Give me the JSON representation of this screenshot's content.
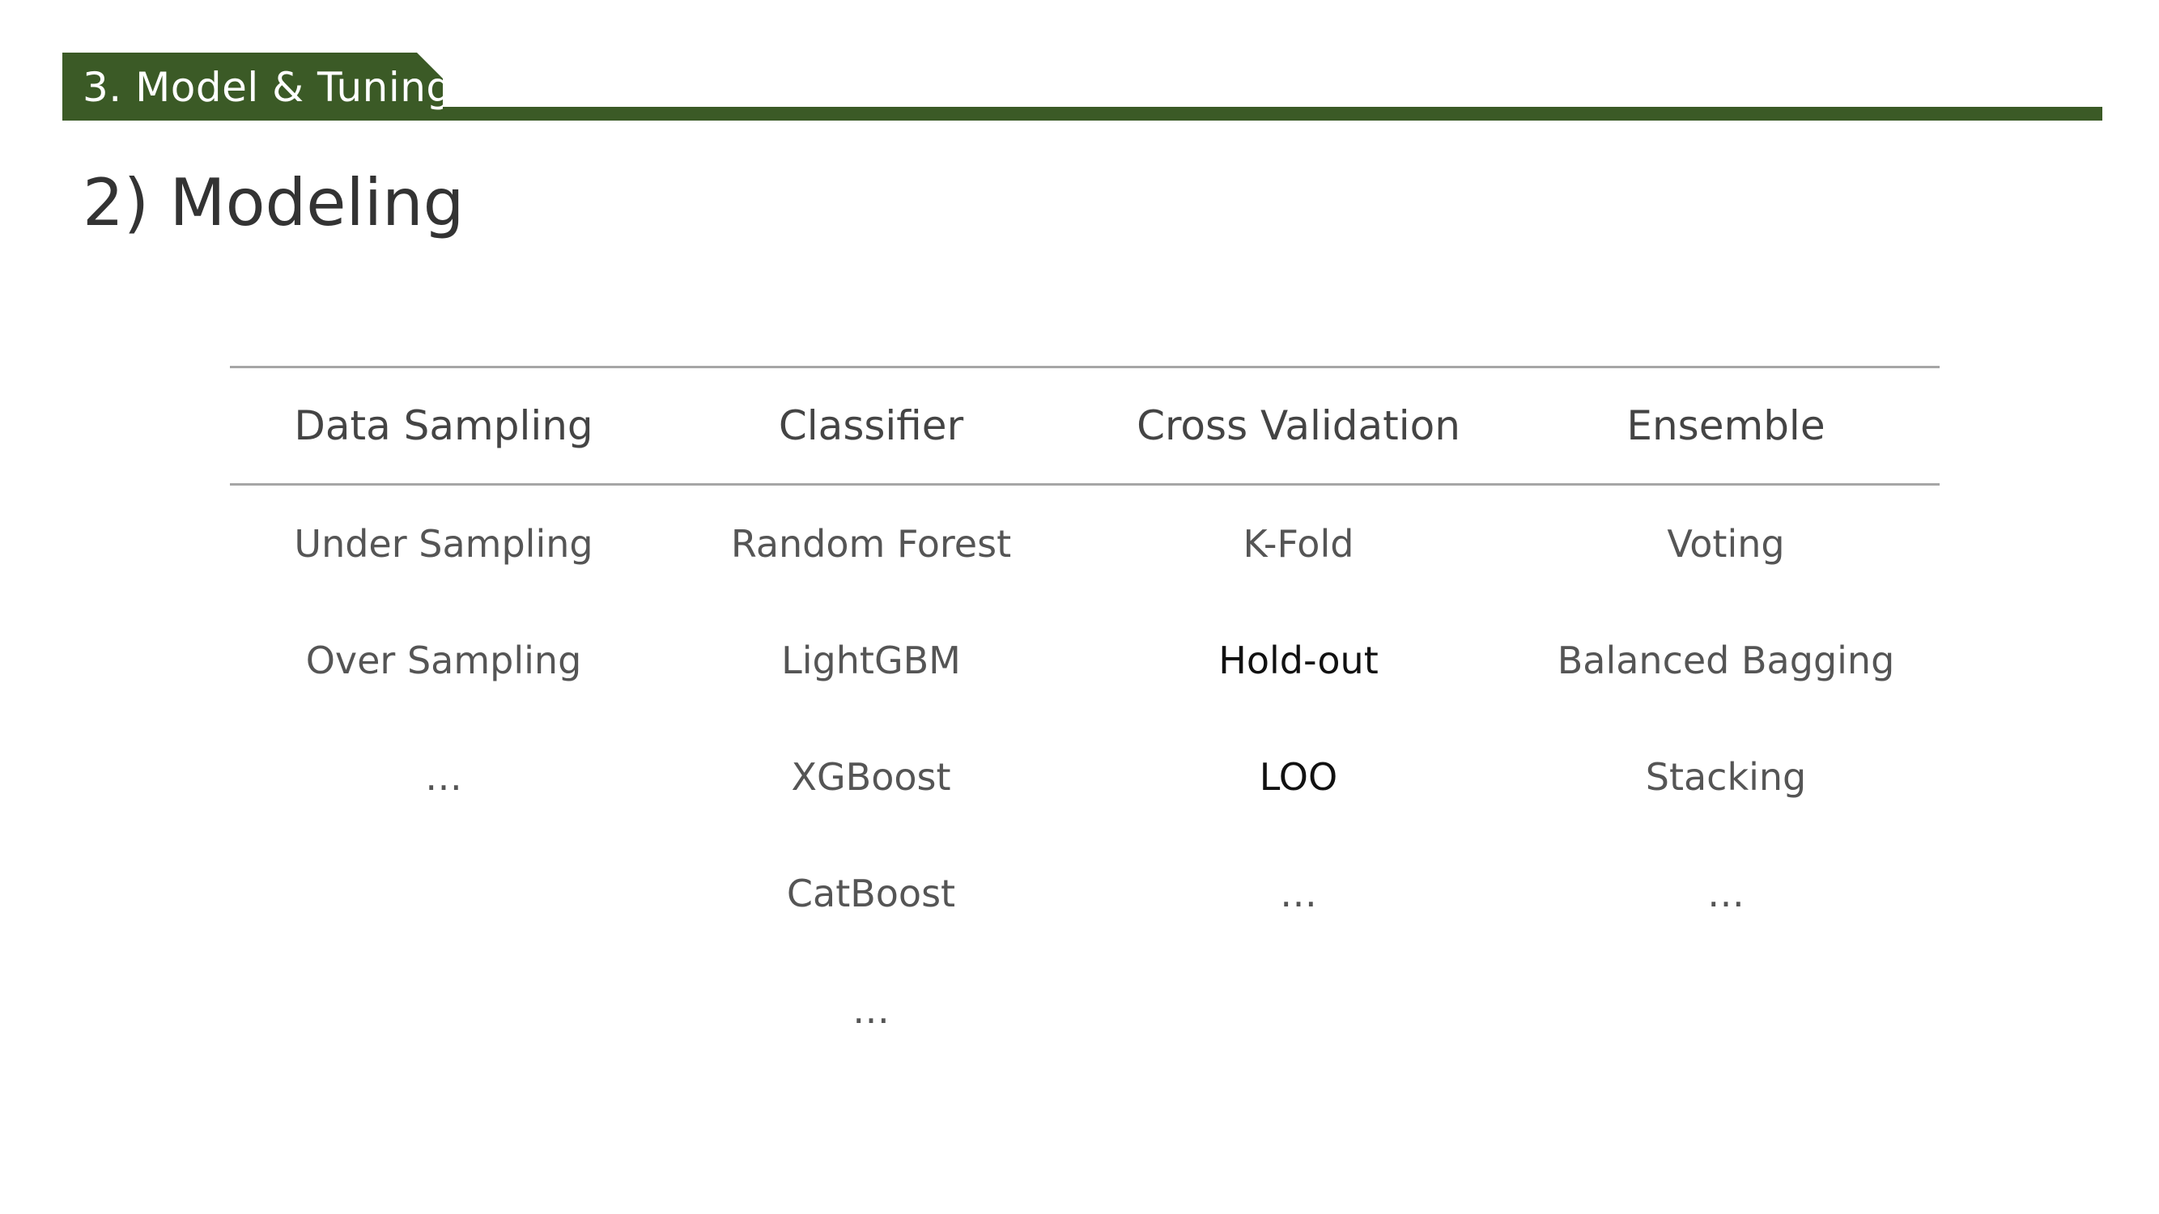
{
  "header": {
    "section_label": "3. Model & Tuning",
    "accent_color": "#3b5a26"
  },
  "page_title": "2) Modeling",
  "table": {
    "columns": [
      "Data Sampling",
      "Classifier",
      "Cross Validation",
      "Ensemble"
    ],
    "rows": [
      [
        "Under Sampling",
        "Random Forest",
        "K-Fold",
        "Voting"
      ],
      [
        "Over Sampling",
        "LightGBM",
        "Hold-out",
        "Balanced Bagging"
      ],
      [
        "…",
        "XGBoost",
        "LOO",
        "Stacking"
      ],
      [
        "",
        "CatBoost",
        "…",
        "…"
      ],
      [
        "",
        "…",
        "",
        ""
      ]
    ]
  }
}
